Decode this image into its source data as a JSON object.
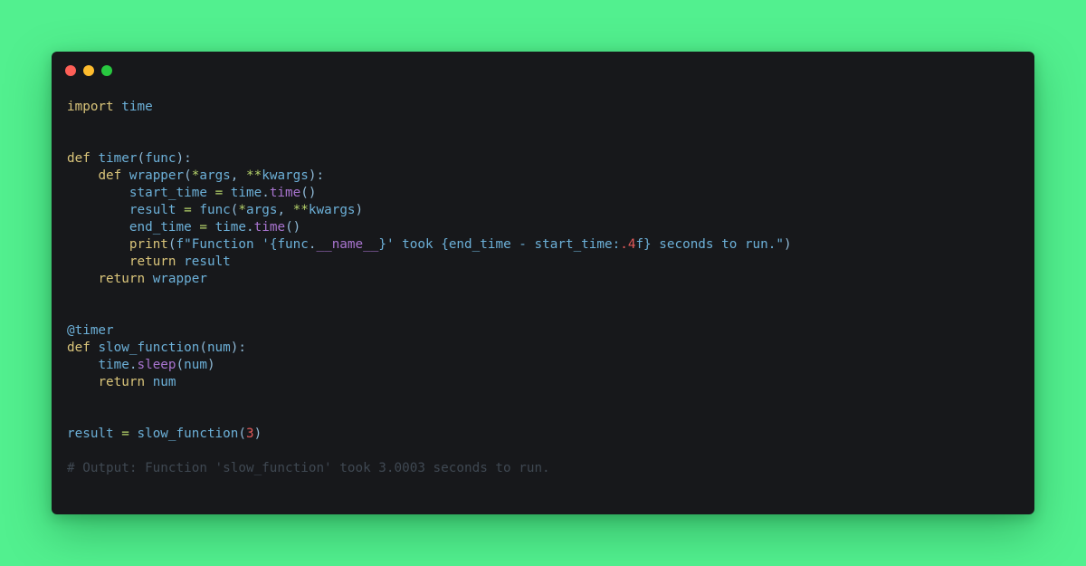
{
  "window": {
    "controls": [
      {
        "name": "close",
        "color": "#fe5f57"
      },
      {
        "name": "minimize",
        "color": "#febc2e"
      },
      {
        "name": "maximize",
        "color": "#28c840"
      }
    ]
  },
  "code": {
    "language": "python",
    "lines": [
      [
        {
          "t": "import",
          "c": "kw"
        },
        {
          "t": " "
        },
        {
          "t": "time",
          "c": "id"
        }
      ],
      [],
      [],
      [
        {
          "t": "def",
          "c": "kw"
        },
        {
          "t": " "
        },
        {
          "t": "timer",
          "c": "id"
        },
        {
          "t": "(",
          "c": "pn"
        },
        {
          "t": "func",
          "c": "id"
        },
        {
          "t": "):",
          "c": "pn"
        }
      ],
      [
        {
          "t": "    "
        },
        {
          "t": "def",
          "c": "kw"
        },
        {
          "t": " "
        },
        {
          "t": "wrapper",
          "c": "id"
        },
        {
          "t": "(",
          "c": "pn"
        },
        {
          "t": "*",
          "c": "op"
        },
        {
          "t": "args",
          "c": "id"
        },
        {
          "t": ", ",
          "c": "pn"
        },
        {
          "t": "**",
          "c": "op"
        },
        {
          "t": "kwargs",
          "c": "id"
        },
        {
          "t": "):",
          "c": "pn"
        }
      ],
      [
        {
          "t": "        "
        },
        {
          "t": "start_time",
          "c": "id"
        },
        {
          "t": " "
        },
        {
          "t": "=",
          "c": "op"
        },
        {
          "t": " "
        },
        {
          "t": "time",
          "c": "id"
        },
        {
          "t": ".",
          "c": "pn"
        },
        {
          "t": "time",
          "c": "fn"
        },
        {
          "t": "()",
          "c": "pn"
        }
      ],
      [
        {
          "t": "        "
        },
        {
          "t": "result",
          "c": "id"
        },
        {
          "t": " "
        },
        {
          "t": "=",
          "c": "op"
        },
        {
          "t": " "
        },
        {
          "t": "func",
          "c": "id"
        },
        {
          "t": "(",
          "c": "pn"
        },
        {
          "t": "*",
          "c": "op"
        },
        {
          "t": "args",
          "c": "id"
        },
        {
          "t": ", ",
          "c": "pn"
        },
        {
          "t": "**",
          "c": "op"
        },
        {
          "t": "kwargs",
          "c": "id"
        },
        {
          "t": ")",
          "c": "pn"
        }
      ],
      [
        {
          "t": "        "
        },
        {
          "t": "end_time",
          "c": "id"
        },
        {
          "t": " "
        },
        {
          "t": "=",
          "c": "op"
        },
        {
          "t": " "
        },
        {
          "t": "time",
          "c": "id"
        },
        {
          "t": ".",
          "c": "pn"
        },
        {
          "t": "time",
          "c": "fn"
        },
        {
          "t": "()",
          "c": "pn"
        }
      ],
      [
        {
          "t": "        "
        },
        {
          "t": "print",
          "c": "kw"
        },
        {
          "t": "(",
          "c": "pn"
        },
        {
          "t": "f\"Function '{",
          "c": "str"
        },
        {
          "t": "func",
          "c": "id"
        },
        {
          "t": ".",
          "c": "pn"
        },
        {
          "t": "__name__",
          "c": "fn"
        },
        {
          "t": "}' took {",
          "c": "str"
        },
        {
          "t": "end_time",
          "c": "id"
        },
        {
          "t": " - ",
          "c": "str"
        },
        {
          "t": "start_time",
          "c": "id"
        },
        {
          "t": ":",
          "c": "str"
        },
        {
          "t": ".4",
          "c": "num"
        },
        {
          "t": "f} seconds to run.\"",
          "c": "str"
        },
        {
          "t": ")",
          "c": "pn"
        }
      ],
      [
        {
          "t": "        "
        },
        {
          "t": "return",
          "c": "kw"
        },
        {
          "t": " "
        },
        {
          "t": "result",
          "c": "id"
        }
      ],
      [
        {
          "t": "    "
        },
        {
          "t": "return",
          "c": "kw"
        },
        {
          "t": " "
        },
        {
          "t": "wrapper",
          "c": "id"
        }
      ],
      [],
      [],
      [
        {
          "t": "@timer",
          "c": "id"
        }
      ],
      [
        {
          "t": "def",
          "c": "kw"
        },
        {
          "t": " "
        },
        {
          "t": "slow_function",
          "c": "id"
        },
        {
          "t": "(",
          "c": "pn"
        },
        {
          "t": "num",
          "c": "id"
        },
        {
          "t": "):",
          "c": "pn"
        }
      ],
      [
        {
          "t": "    "
        },
        {
          "t": "time",
          "c": "id"
        },
        {
          "t": ".",
          "c": "pn"
        },
        {
          "t": "sleep",
          "c": "fn"
        },
        {
          "t": "(",
          "c": "pn"
        },
        {
          "t": "num",
          "c": "id"
        },
        {
          "t": ")",
          "c": "pn"
        }
      ],
      [
        {
          "t": "    "
        },
        {
          "t": "return",
          "c": "kw"
        },
        {
          "t": " "
        },
        {
          "t": "num",
          "c": "id"
        }
      ],
      [],
      [],
      [
        {
          "t": "result",
          "c": "id"
        },
        {
          "t": " "
        },
        {
          "t": "=",
          "c": "op"
        },
        {
          "t": " "
        },
        {
          "t": "slow_function",
          "c": "id"
        },
        {
          "t": "(",
          "c": "pn"
        },
        {
          "t": "3",
          "c": "num"
        },
        {
          "t": ")",
          "c": "pn"
        }
      ],
      [],
      [
        {
          "t": "# Output: Function 'slow_function' took 3.0003 seconds to run.",
          "c": "cm"
        }
      ]
    ]
  }
}
